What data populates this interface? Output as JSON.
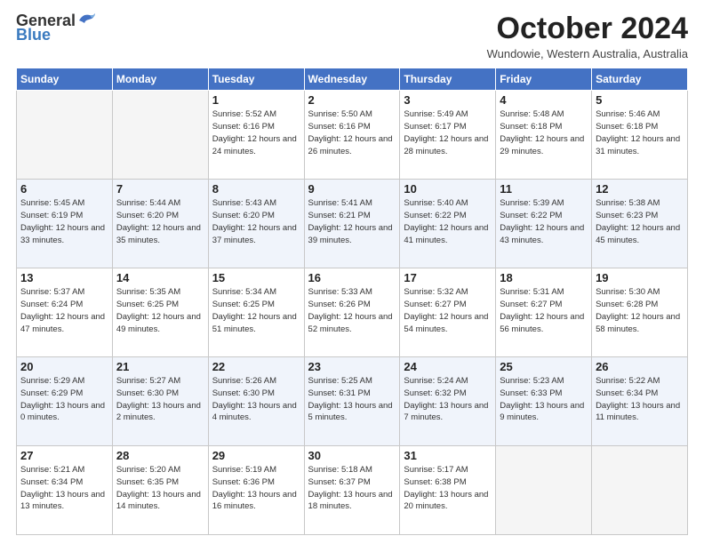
{
  "header": {
    "logo_general": "General",
    "logo_blue": "Blue",
    "month": "October 2024",
    "location": "Wundowie, Western Australia, Australia"
  },
  "days_of_week": [
    "Sunday",
    "Monday",
    "Tuesday",
    "Wednesday",
    "Thursday",
    "Friday",
    "Saturday"
  ],
  "weeks": [
    [
      {
        "day": "",
        "info": ""
      },
      {
        "day": "",
        "info": ""
      },
      {
        "day": "1",
        "info": "Sunrise: 5:52 AM\nSunset: 6:16 PM\nDaylight: 12 hours and 24 minutes."
      },
      {
        "day": "2",
        "info": "Sunrise: 5:50 AM\nSunset: 6:16 PM\nDaylight: 12 hours and 26 minutes."
      },
      {
        "day": "3",
        "info": "Sunrise: 5:49 AM\nSunset: 6:17 PM\nDaylight: 12 hours and 28 minutes."
      },
      {
        "day": "4",
        "info": "Sunrise: 5:48 AM\nSunset: 6:18 PM\nDaylight: 12 hours and 29 minutes."
      },
      {
        "day": "5",
        "info": "Sunrise: 5:46 AM\nSunset: 6:18 PM\nDaylight: 12 hours and 31 minutes."
      }
    ],
    [
      {
        "day": "6",
        "info": "Sunrise: 5:45 AM\nSunset: 6:19 PM\nDaylight: 12 hours and 33 minutes."
      },
      {
        "day": "7",
        "info": "Sunrise: 5:44 AM\nSunset: 6:20 PM\nDaylight: 12 hours and 35 minutes."
      },
      {
        "day": "8",
        "info": "Sunrise: 5:43 AM\nSunset: 6:20 PM\nDaylight: 12 hours and 37 minutes."
      },
      {
        "day": "9",
        "info": "Sunrise: 5:41 AM\nSunset: 6:21 PM\nDaylight: 12 hours and 39 minutes."
      },
      {
        "day": "10",
        "info": "Sunrise: 5:40 AM\nSunset: 6:22 PM\nDaylight: 12 hours and 41 minutes."
      },
      {
        "day": "11",
        "info": "Sunrise: 5:39 AM\nSunset: 6:22 PM\nDaylight: 12 hours and 43 minutes."
      },
      {
        "day": "12",
        "info": "Sunrise: 5:38 AM\nSunset: 6:23 PM\nDaylight: 12 hours and 45 minutes."
      }
    ],
    [
      {
        "day": "13",
        "info": "Sunrise: 5:37 AM\nSunset: 6:24 PM\nDaylight: 12 hours and 47 minutes."
      },
      {
        "day": "14",
        "info": "Sunrise: 5:35 AM\nSunset: 6:25 PM\nDaylight: 12 hours and 49 minutes."
      },
      {
        "day": "15",
        "info": "Sunrise: 5:34 AM\nSunset: 6:25 PM\nDaylight: 12 hours and 51 minutes."
      },
      {
        "day": "16",
        "info": "Sunrise: 5:33 AM\nSunset: 6:26 PM\nDaylight: 12 hours and 52 minutes."
      },
      {
        "day": "17",
        "info": "Sunrise: 5:32 AM\nSunset: 6:27 PM\nDaylight: 12 hours and 54 minutes."
      },
      {
        "day": "18",
        "info": "Sunrise: 5:31 AM\nSunset: 6:27 PM\nDaylight: 12 hours and 56 minutes."
      },
      {
        "day": "19",
        "info": "Sunrise: 5:30 AM\nSunset: 6:28 PM\nDaylight: 12 hours and 58 minutes."
      }
    ],
    [
      {
        "day": "20",
        "info": "Sunrise: 5:29 AM\nSunset: 6:29 PM\nDaylight: 13 hours and 0 minutes."
      },
      {
        "day": "21",
        "info": "Sunrise: 5:27 AM\nSunset: 6:30 PM\nDaylight: 13 hours and 2 minutes."
      },
      {
        "day": "22",
        "info": "Sunrise: 5:26 AM\nSunset: 6:30 PM\nDaylight: 13 hours and 4 minutes."
      },
      {
        "day": "23",
        "info": "Sunrise: 5:25 AM\nSunset: 6:31 PM\nDaylight: 13 hours and 5 minutes."
      },
      {
        "day": "24",
        "info": "Sunrise: 5:24 AM\nSunset: 6:32 PM\nDaylight: 13 hours and 7 minutes."
      },
      {
        "day": "25",
        "info": "Sunrise: 5:23 AM\nSunset: 6:33 PM\nDaylight: 13 hours and 9 minutes."
      },
      {
        "day": "26",
        "info": "Sunrise: 5:22 AM\nSunset: 6:34 PM\nDaylight: 13 hours and 11 minutes."
      }
    ],
    [
      {
        "day": "27",
        "info": "Sunrise: 5:21 AM\nSunset: 6:34 PM\nDaylight: 13 hours and 13 minutes."
      },
      {
        "day": "28",
        "info": "Sunrise: 5:20 AM\nSunset: 6:35 PM\nDaylight: 13 hours and 14 minutes."
      },
      {
        "day": "29",
        "info": "Sunrise: 5:19 AM\nSunset: 6:36 PM\nDaylight: 13 hours and 16 minutes."
      },
      {
        "day": "30",
        "info": "Sunrise: 5:18 AM\nSunset: 6:37 PM\nDaylight: 13 hours and 18 minutes."
      },
      {
        "day": "31",
        "info": "Sunrise: 5:17 AM\nSunset: 6:38 PM\nDaylight: 13 hours and 20 minutes."
      },
      {
        "day": "",
        "info": ""
      },
      {
        "day": "",
        "info": ""
      }
    ]
  ]
}
